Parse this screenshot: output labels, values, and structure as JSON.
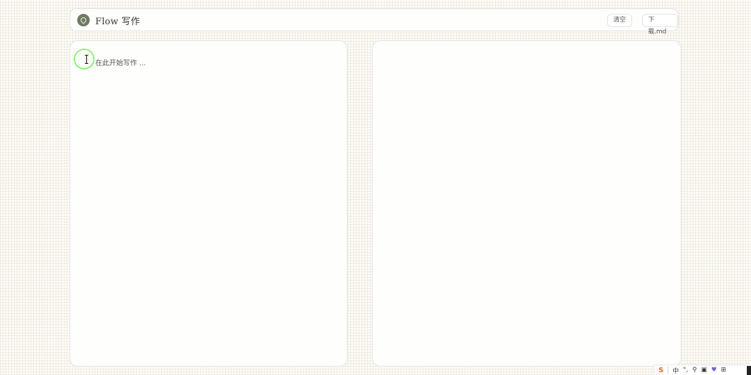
{
  "header": {
    "app_title": "Flow 写作",
    "clear_label": "清空",
    "download_label": "下载.md"
  },
  "editor": {
    "placeholder": "在此开始写作 ..."
  },
  "taskbar": {
    "ime_label": "中",
    "icons": [
      "sogou-s-icon",
      "chinese-input-icon",
      "punctuation-icon",
      "mic-icon",
      "keyboard-icon",
      "skin-icon",
      "grid-icon",
      "toolbox-icon"
    ]
  },
  "colors": {
    "accent_logo": "#6e7b66",
    "cursor_ring": "#8ef27a"
  }
}
